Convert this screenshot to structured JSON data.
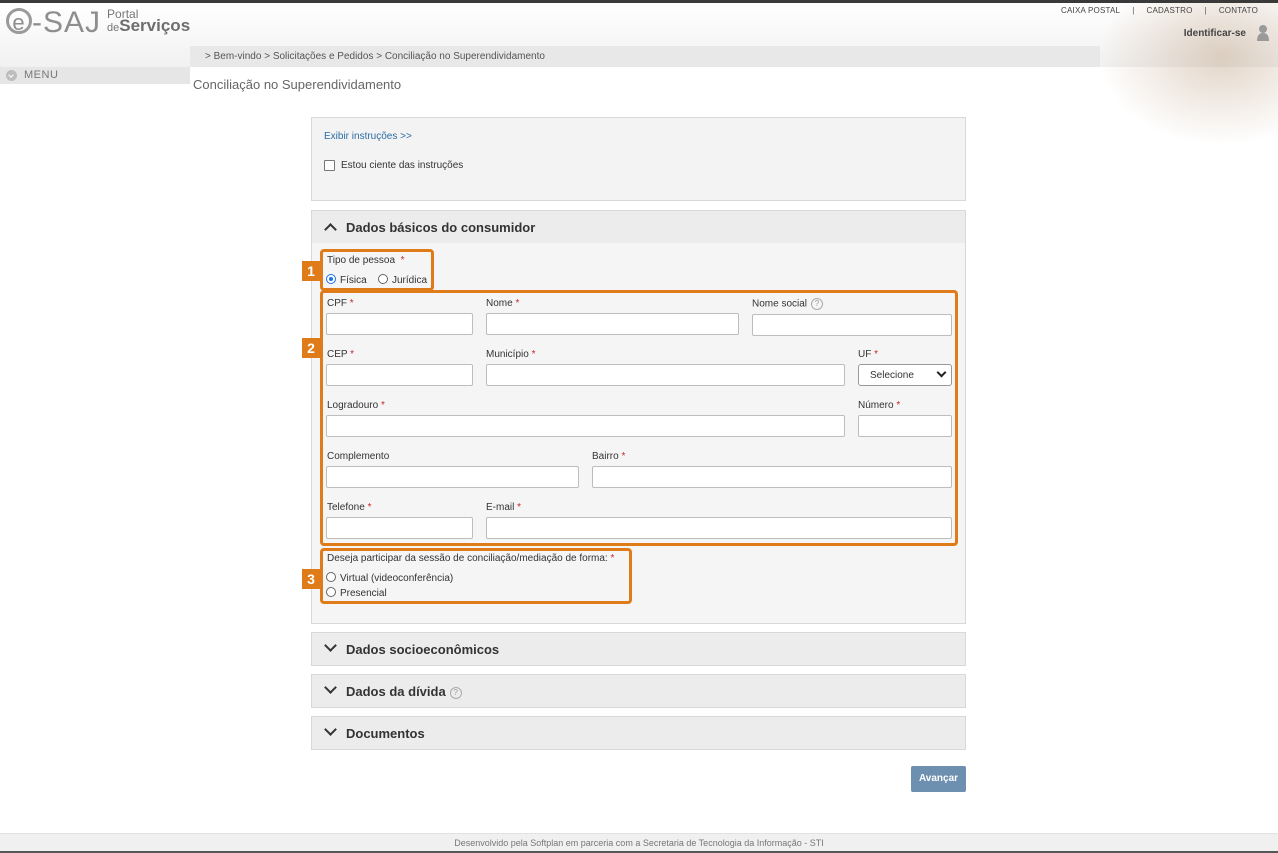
{
  "header": {
    "logo_esaj_e": "e",
    "logo_esaj_rest": "-SAJ",
    "logo_portal": "Portal",
    "logo_de": "de",
    "logo_servicos": "Serviços",
    "toplinks": [
      "CAIXA POSTAL",
      "CADASTRO",
      "CONTATO"
    ],
    "identificar": "Identificar-se",
    "breadcrumb": "> Bem-vindo > Solicitações e Pedidos > Conciliação no Superendividamento",
    "menu_label": "MENU",
    "page_title": "Conciliação no Superendividamento"
  },
  "instructions": {
    "link": "Exibir instruções >>",
    "checkbox_label": "Estou ciente das instruções"
  },
  "basic": {
    "title": "Dados básicos do consumidor",
    "tipo_label": "Tipo de pessoa",
    "tipo_options": [
      "Física",
      "Jurídica"
    ],
    "tipo_selected": "Física",
    "fields": {
      "cpf": "CPF",
      "nome": "Nome",
      "nome_social": "Nome social",
      "cep": "CEP",
      "municipio": "Município",
      "uf": "UF",
      "uf_value": "Selecione",
      "logradouro": "Logradouro",
      "numero": "Número",
      "complemento": "Complemento",
      "bairro": "Bairro",
      "telefone": "Telefone",
      "email": "E-mail"
    },
    "required_mark": "*",
    "help_mark": "?",
    "sessao_label": "Deseja participar da sessão de conciliação/mediação de forma:",
    "sessao_options": [
      "Virtual (videoconferência)",
      "Presencial"
    ]
  },
  "sections": [
    {
      "title": "Dados socioeconômicos"
    },
    {
      "title": "Dados da dívida"
    },
    {
      "title": "Documentos"
    }
  ],
  "annotations": [
    "1",
    "2",
    "3"
  ],
  "actions": {
    "avancar": "Avançar"
  },
  "footer": "Desenvolvido pela Softplan em parceria com a Secretaria de Tecnologia da Informação - STI",
  "colors": {
    "highlight": "#e07b1a",
    "button": "#6d8fb0",
    "link": "#2b6ca3"
  }
}
